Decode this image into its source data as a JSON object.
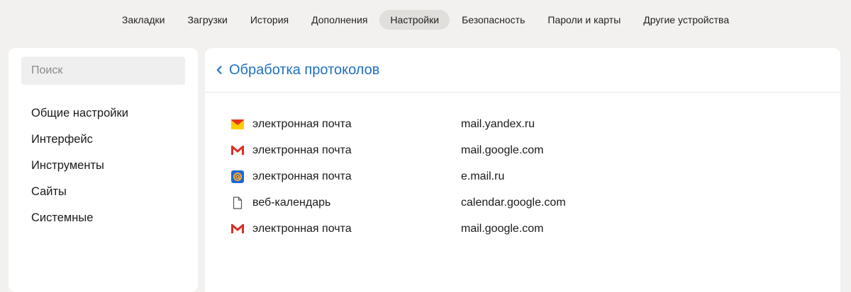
{
  "nav": {
    "tabs": [
      {
        "label": "Закладки"
      },
      {
        "label": "Загрузки"
      },
      {
        "label": "История"
      },
      {
        "label": "Дополнения"
      },
      {
        "label": "Настройки",
        "active": true
      },
      {
        "label": "Безопасность"
      },
      {
        "label": "Пароли и карты"
      },
      {
        "label": "Другие устройства"
      }
    ]
  },
  "sidebar": {
    "search_placeholder": "Поиск",
    "items": [
      {
        "label": "Общие настройки"
      },
      {
        "label": "Интерфейс"
      },
      {
        "label": "Инструменты"
      },
      {
        "label": "Сайты"
      },
      {
        "label": "Системные"
      }
    ]
  },
  "main": {
    "title": "Обработка протоколов",
    "handlers": [
      {
        "icon": "yandex-mail-icon",
        "type": "электронная почта",
        "host": "mail.yandex.ru"
      },
      {
        "icon": "gmail-icon",
        "type": "электронная почта",
        "host": "mail.google.com"
      },
      {
        "icon": "mailru-icon",
        "type": "электронная почта",
        "host": "e.mail.ru"
      },
      {
        "icon": "page-icon",
        "type": "веб-календарь",
        "host": "calendar.google.com"
      },
      {
        "icon": "gmail-icon",
        "type": "электронная почта",
        "host": "mail.google.com"
      }
    ]
  },
  "colors": {
    "accent": "#1f6fc0",
    "active_tab": "#e0dfdc",
    "background": "#f2f1ef"
  }
}
